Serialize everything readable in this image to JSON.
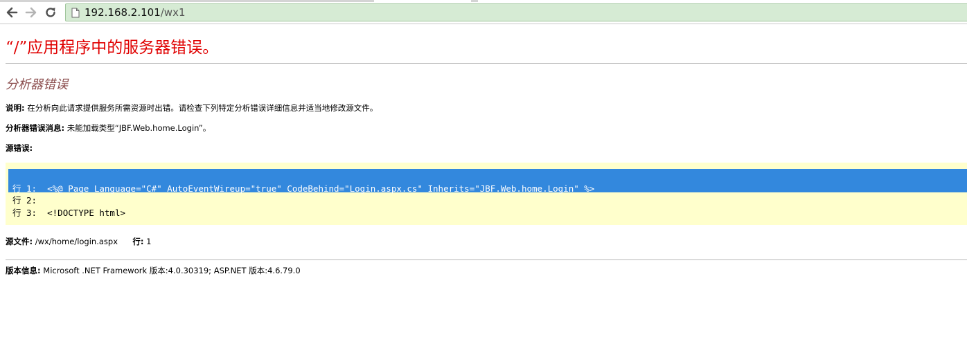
{
  "browser": {
    "url_host": "192.168.2.101",
    "url_path": "/wx1"
  },
  "page": {
    "title": "“/”应用程序中的服务器错误。",
    "subtitle": "分析器错误",
    "description_label": "说明:",
    "description_text": "在分析向此请求提供服务所需资源时出错。请检查下列特定分析错误详细信息并适当地修改源文件。",
    "parser_msg_label": "分析器错误消息:",
    "parser_msg_text": "未能加载类型“JBF.Web.home.Login”。",
    "source_error_label": "源错误:",
    "code_lines": [
      "行 1:  <%@ Page Language=\"C#\" AutoEventWireup=\"true\" CodeBehind=\"Login.aspx.cs\" Inherits=\"JBF.Web.home.Login\" %>",
      "行 2:",
      "行 3:  <!DOCTYPE html>"
    ],
    "source_file_label": "源文件:",
    "source_file_value": "/wx/home/login.aspx",
    "line_label": "行:",
    "line_value": "1",
    "version_label": "版本信息:",
    "version_text": "Microsoft .NET Framework 版本:4.0.30319; ASP.NET 版本:4.6.79.0"
  },
  "colors": {
    "title": "#e00000",
    "subtitle": "#8b4d4d",
    "code_background": "#ffffcc",
    "selection": "#3388dd",
    "omnibox": "#d6ebd4"
  }
}
